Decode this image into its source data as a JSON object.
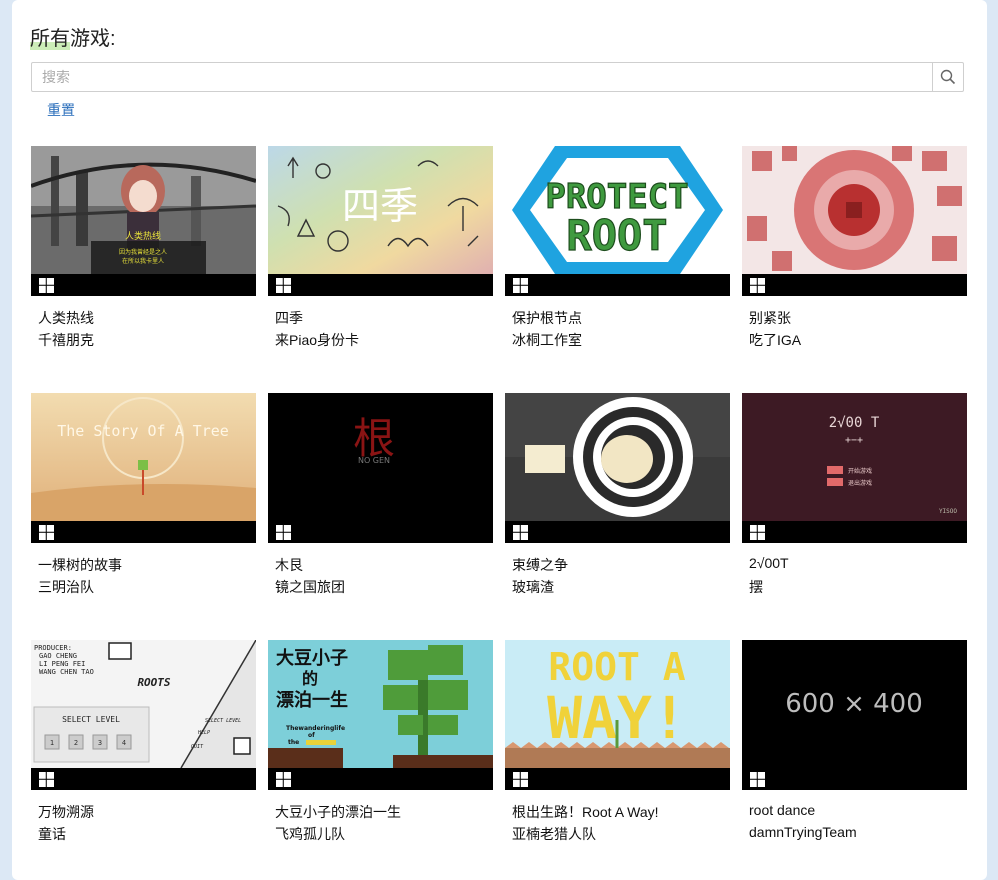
{
  "page": {
    "heading": "所有游戏:",
    "search": {
      "placeholder": "搜索",
      "value": "",
      "icon": "search-icon"
    },
    "reset_label": "重置"
  },
  "games": [
    {
      "title": "人类热线",
      "author": "千禧朋克",
      "art_text": "人类热线",
      "art_sub1": "因为我曾经是之人",
      "art_sub2": "在所以我卡里人",
      "platform": "windows-icon"
    },
    {
      "title": "四季",
      "author": "来Piao身份卡",
      "art_text": "四季",
      "platform": "windows-icon"
    },
    {
      "title": "保护根节点",
      "author": "冰桐工作室",
      "art_text1": "PROTECT",
      "art_text2": "ROOT",
      "platform": "windows-icon"
    },
    {
      "title": "别紧张",
      "author": "吃了IGA",
      "platform": "windows-icon"
    },
    {
      "title": "一棵树的故事",
      "author": "三明治队",
      "art_text": "The Story Of A Tree",
      "platform": "windows-icon"
    },
    {
      "title": "木艮",
      "author": "镜之国旅团",
      "art_text": "根",
      "art_sub": "NO GEN",
      "platform": "windows-icon"
    },
    {
      "title": "束缚之争",
      "author": "玻璃渣",
      "platform": "windows-icon"
    },
    {
      "title": "2√00T",
      "author": "摆",
      "art_text": "2√00 T",
      "art_sub": "+−+",
      "art_btn1": "开始游戏",
      "art_btn2": "退出游戏",
      "art_corner": "YISOO",
      "platform": "windows-icon"
    },
    {
      "title": "万物溯源",
      "author": "童话",
      "art_credits": [
        "PRODUCER:",
        "GAO CHENG",
        "LI PENG FEI",
        "WANG CHEN TAO"
      ],
      "art_logo": "ROOTS",
      "art_select": "SELECT LEVEL",
      "art_levels": [
        "1",
        "2",
        "3",
        "4"
      ],
      "art_menu": [
        "SELECT LEVEL",
        "HELP",
        "QUIT"
      ],
      "platform": "windows-icon"
    },
    {
      "title": "大豆小子的漂泊一生",
      "author": "飞鸡孤儿队",
      "art_text1": "大豆小子",
      "art_text2": "的",
      "art_text3": "漂泊一生",
      "art_sub1": "Thewanderinglife",
      "art_sub2": "of",
      "art_sub3": "the",
      "platform": "windows-icon"
    },
    {
      "title": "根出生路！Root A Way!",
      "author": "亚楠老猎人队",
      "art_text1": "ROOT A",
      "art_text2": "WAY!",
      "platform": "windows-icon"
    },
    {
      "title": "root dance",
      "author": "damnTryingTeam",
      "art_text": "600 × 400",
      "platform": "windows-icon"
    }
  ]
}
